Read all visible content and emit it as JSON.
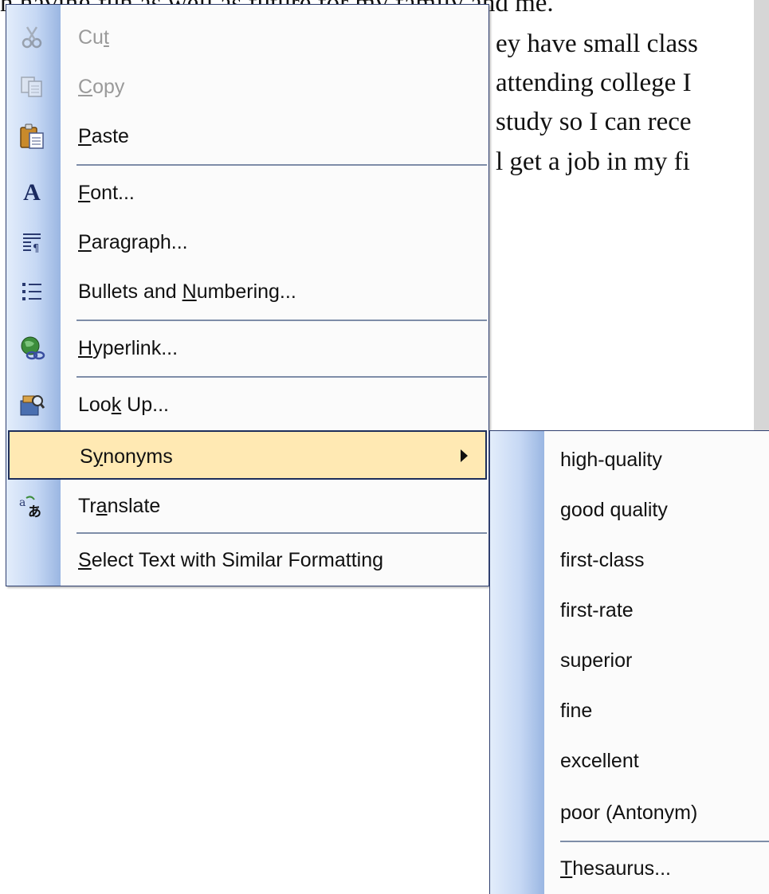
{
  "document": {
    "lines": [
      "n having fun as well as future for my family and me.",
      "ey have small class",
      "attending college I",
      "study so I can rece",
      "l get a job in my fi"
    ]
  },
  "context_menu": {
    "items": [
      {
        "label_pre": "Cu",
        "accel": "t",
        "label_post": "",
        "icon": "scissors-icon",
        "disabled": true
      },
      {
        "label_pre": "",
        "accel": "C",
        "label_post": "opy",
        "icon": "copy-icon",
        "disabled": true
      },
      {
        "label_pre": "",
        "accel": "P",
        "label_post": "aste",
        "icon": "clipboard-paste-icon",
        "disabled": false
      },
      {
        "label_pre": "",
        "accel": "F",
        "label_post": "ont...",
        "icon": "font-icon",
        "disabled": false
      },
      {
        "label_pre": "",
        "accel": "P",
        "label_post": "aragraph...",
        "icon": "paragraph-icon",
        "disabled": false
      },
      {
        "label_pre": "Bullets and ",
        "accel": "N",
        "label_post": "umbering...",
        "icon": "bullets-icon",
        "disabled": false
      },
      {
        "label_pre": "",
        "accel": "H",
        "label_post": "yperlink...",
        "icon": "hyperlink-globe-icon",
        "disabled": false
      },
      {
        "label_pre": "Loo",
        "accel": "k",
        "label_post": " Up...",
        "icon": "research-book-icon",
        "disabled": false
      },
      {
        "label_pre": "S",
        "accel": "y",
        "label_post": "nonyms",
        "icon": "",
        "disabled": false,
        "highlighted": true,
        "has_submenu": true
      },
      {
        "label_pre": "Tr",
        "accel": "a",
        "label_post": "nslate",
        "icon": "translate-icon",
        "disabled": false
      },
      {
        "label_pre": "",
        "accel": "S",
        "label_post": "elect Text with Similar Formatting",
        "icon": "",
        "disabled": false
      }
    ]
  },
  "synonyms_submenu": {
    "items": [
      "high-quality",
      "good quality",
      "first-class",
      "first-rate",
      "superior",
      "fine",
      "excellent",
      "poor (Antonym)"
    ],
    "thesaurus": {
      "accel": "T",
      "label_post": "hesaurus..."
    }
  },
  "colors": {
    "highlight": "#ffe9b3",
    "menu_border": "#2f3f6f",
    "disabled_text": "#9a9a9a"
  }
}
